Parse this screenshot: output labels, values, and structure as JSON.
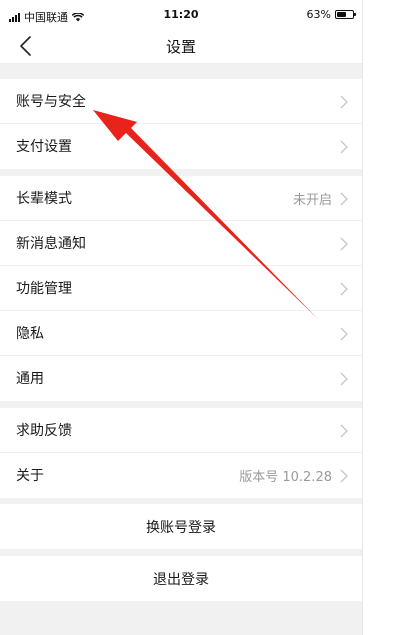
{
  "status_bar": {
    "carrier": "中国联通",
    "time": "11:20",
    "battery_text": "63%",
    "battery_level": 0.63,
    "icons": [
      "signal-icon",
      "wifi-icon",
      "battery-icon"
    ]
  },
  "nav": {
    "title": "设置",
    "back_icon": "chevron-left-icon"
  },
  "groups": [
    {
      "items": [
        {
          "label": "账号与安全",
          "value": ""
        },
        {
          "label": "支付设置",
          "value": ""
        }
      ]
    },
    {
      "items": [
        {
          "label": "长辈模式",
          "value": "未开启"
        },
        {
          "label": "新消息通知",
          "value": ""
        },
        {
          "label": "功能管理",
          "value": ""
        },
        {
          "label": "隐私",
          "value": ""
        },
        {
          "label": "通用",
          "value": ""
        }
      ]
    },
    {
      "items": [
        {
          "label": "求助反馈",
          "value": ""
        },
        {
          "label": "关于",
          "value": "版本号 10.2.28"
        }
      ]
    }
  ],
  "actions": {
    "switch_account": "换账号登录",
    "logout": "退出登录"
  },
  "annotation": {
    "color": "#e8231b",
    "icon": "red-arrow-icon"
  },
  "colors": {
    "background": "#f1f1f1",
    "cell": "#ffffff",
    "text": "#1a1a1a",
    "secondary_text": "#9a9a9a"
  }
}
